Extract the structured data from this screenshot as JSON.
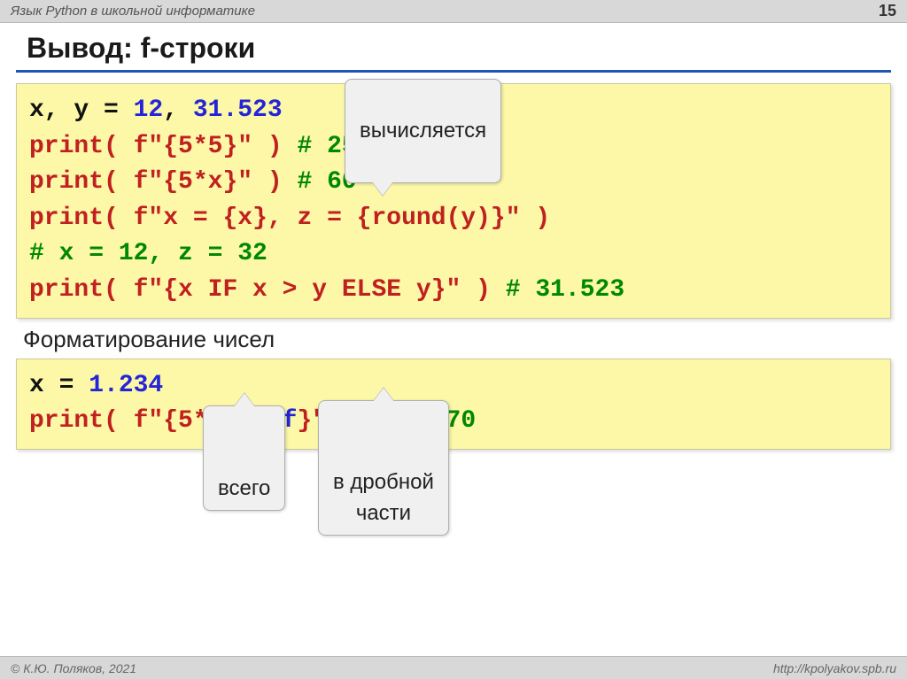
{
  "header": {
    "lecture": "Язык Python в школьной  информатике",
    "page": "15"
  },
  "title": "Вывод: f-строки",
  "callouts": {
    "computed": "вычисляется",
    "total": "всего",
    "fractional": "в дробной\nчасти"
  },
  "code1": {
    "l1": {
      "a": "x, y = ",
      "n1": "12",
      "c": ", ",
      "n2": "31.523"
    },
    "l2": {
      "fn": "print",
      "open": "( f\"{",
      "expr": "5*5",
      "close": "}\" )",
      "cmt": "  # 25"
    },
    "l3": {
      "fn": "print",
      "open": "( f\"{",
      "expr": "5*x",
      "close": "}\" )",
      "cmt": "  # 60"
    },
    "l4": {
      "fn": "print",
      "open": "( f\"x = {",
      "e1": "x",
      "mid": "}, z = {",
      "rnd": "round",
      "arg": "(y)",
      "close": "}\" )"
    },
    "l5": {
      "cmt": "  # x = 12, z = 32"
    },
    "l6": {
      "fn": "print",
      "open": "( f\"{",
      "e1": "x ",
      "if": "IF",
      "e2": " x > y ",
      "else": "ELSE",
      "e3": " y",
      "close": "}\" )",
      "cmt": "  # 31.523"
    }
  },
  "subhead": "Форматирование чисел",
  "code2": {
    "l1": {
      "a": "x = ",
      "n": "1.234"
    },
    "l2": {
      "fn": "print",
      "open": "( f\"{",
      "expr": "5*x",
      "fmt": ":0.3f",
      "close": "}\")",
      "cmt": "  // 6.170"
    }
  },
  "footer": {
    "copyright": "© К.Ю. Поляков, 2021",
    "url": "http://kpolyakov.spb.ru"
  }
}
